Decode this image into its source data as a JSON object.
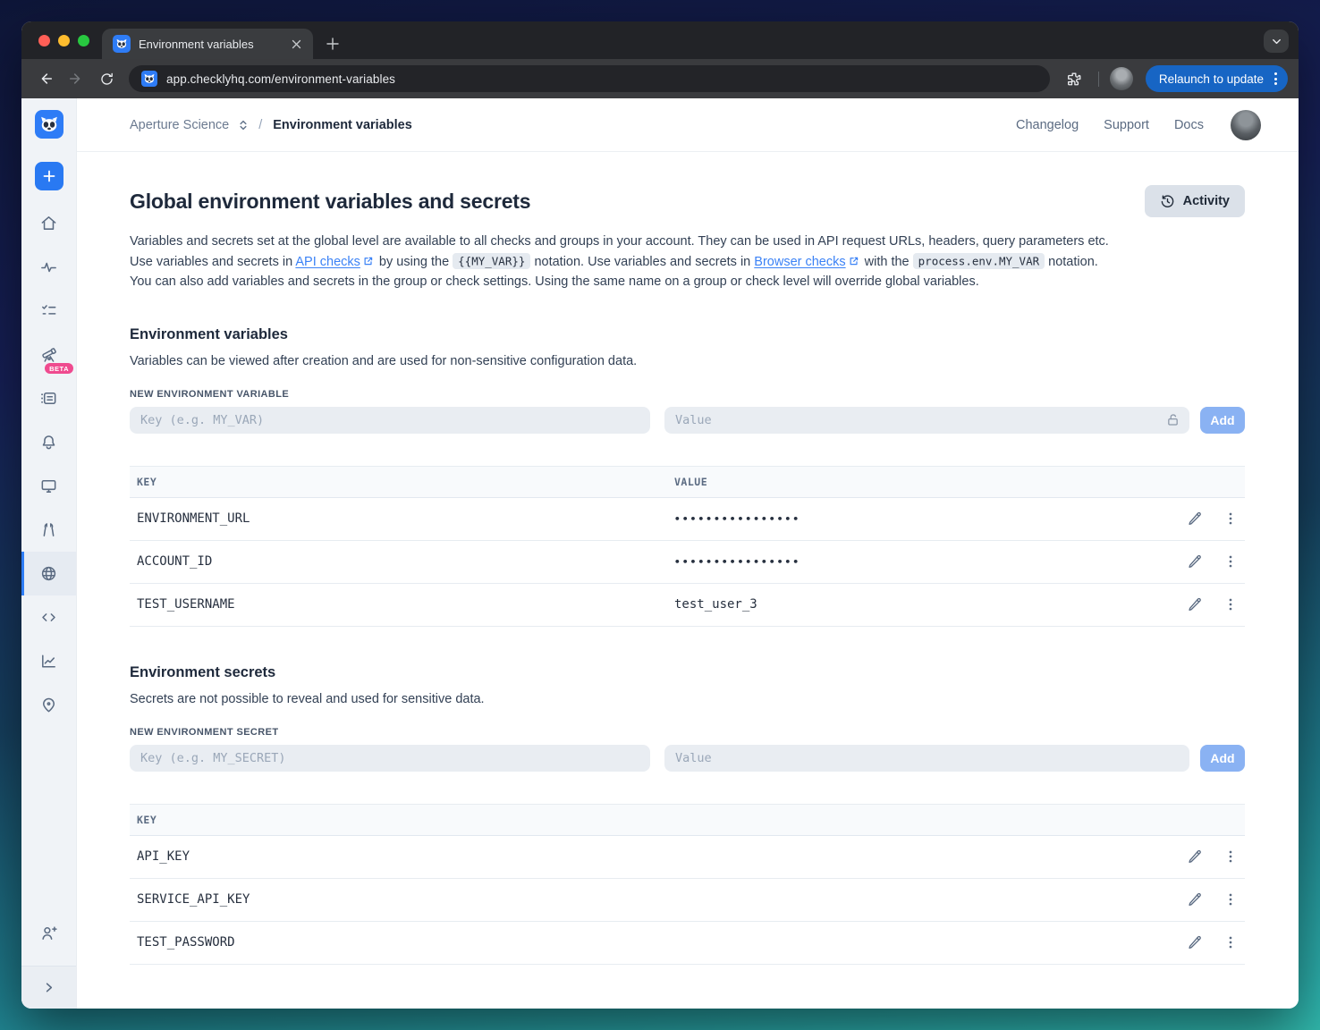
{
  "colors": {
    "accent_blue": "#2e7df6",
    "add_button_blue": "#8ab2f3",
    "relaunch_blue": "#1765c4",
    "link_blue": "#3b82f6",
    "beta_pink": "#ef4a8f",
    "sidebar_bg": "#f0f3f7",
    "chrome_dark": "#222327"
  },
  "browser": {
    "tab_title": "Environment variables",
    "url": "app.checklyhq.com/environment-variables",
    "relaunch_label": "Relaunch to update"
  },
  "header": {
    "breadcrumb": {
      "account": "Aperture Science",
      "separator": "/",
      "page": "Environment variables"
    },
    "links": [
      {
        "label": "Changelog"
      },
      {
        "label": "Support"
      },
      {
        "label": "Docs"
      }
    ]
  },
  "sidebar": {
    "beta_badge": "BETA",
    "items": [
      {
        "icon": "checkly-logo-icon"
      },
      {
        "icon": "create-plus-icon"
      },
      {
        "icon": "home-icon"
      },
      {
        "icon": "pulse-icon"
      },
      {
        "icon": "checklist-icon"
      },
      {
        "icon": "telescope-icon"
      },
      {
        "icon": "runner-log-icon"
      },
      {
        "icon": "bell-icon"
      },
      {
        "icon": "monitor-icon"
      },
      {
        "icon": "maintenance-icon"
      },
      {
        "icon": "globe-icon",
        "active": true
      },
      {
        "icon": "code-icon"
      },
      {
        "icon": "chart-icon"
      },
      {
        "icon": "location-pin-icon"
      },
      {
        "icon": "invite-user-icon"
      },
      {
        "icon": "collapse-chevron-icon"
      }
    ]
  },
  "main": {
    "title": "Global environment variables and secrets",
    "activity_button": "Activity",
    "intro": {
      "part1": "Variables and secrets set at the global level are available to all checks and groups in your account. They can be used in API request URLs, headers, query parameters etc. Use variables and secrets in ",
      "link1": "API checks",
      "part2": " by using the ",
      "code1": "{{MY_VAR}}",
      "part3": " notation. Use variables and secrets in ",
      "link2": "Browser checks",
      "part4": " with the ",
      "code2": "process.env.MY_VAR",
      "part5": " notation. You can also add variables and secrets in the group or check settings. Using the same name on a group or check level will override global variables."
    },
    "variables": {
      "heading": "Environment variables",
      "description": "Variables can be viewed after creation and are used for non-sensitive configuration data.",
      "form_label": "NEW ENVIRONMENT VARIABLE",
      "key_placeholder": "Key (e.g. MY_VAR)",
      "value_placeholder": "Value",
      "add_button": "Add",
      "table": {
        "key_header": "KEY",
        "value_header": "VALUE",
        "rows": [
          {
            "key": "ENVIRONMENT_URL",
            "value": "••••••••••••••••",
            "masked": true
          },
          {
            "key": "ACCOUNT_ID",
            "value": "••••••••••••••••",
            "masked": true
          },
          {
            "key": "TEST_USERNAME",
            "value": "test_user_3",
            "masked": false
          }
        ]
      }
    },
    "secrets": {
      "heading": "Environment secrets",
      "description": "Secrets are not possible to reveal and used for sensitive data.",
      "form_label": "NEW ENVIRONMENT SECRET",
      "key_placeholder": "Key (e.g. MY_SECRET)",
      "value_placeholder": "Value",
      "add_button": "Add",
      "table": {
        "key_header": "KEY",
        "rows": [
          {
            "key": "API_KEY"
          },
          {
            "key": "SERVICE_API_KEY"
          },
          {
            "key": "TEST_PASSWORD"
          }
        ]
      }
    }
  }
}
